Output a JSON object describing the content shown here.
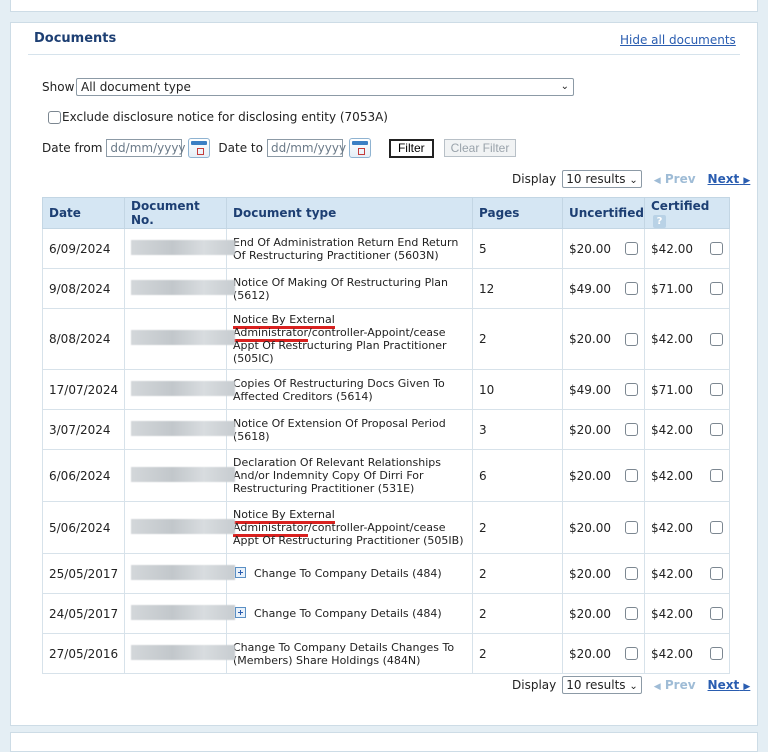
{
  "documents": {
    "title": "Documents",
    "hide_link": "Hide all documents",
    "show_label": "Show",
    "show_selected": "All document type",
    "exclude_label": "Exclude disclosure notice for disclosing entity (7053A)",
    "date_from_label": "Date from",
    "date_to_label": "Date to",
    "date_placeholder": "dd/mm/yyyy",
    "filter_label": "Filter",
    "clear_filter_label": "Clear Filter",
    "pager": {
      "display_label": "Display",
      "page_size": "10 results",
      "prev": "Prev",
      "next": "Next"
    },
    "columns": [
      "Date",
      "Document No.",
      "Document type",
      "Pages",
      "Uncertified",
      "Certified"
    ],
    "rows": [
      {
        "date": "6/09/2024",
        "type": "End Of Administration Return End Return Of Restructuring Practitioner (5603N)",
        "pages": "5",
        "uncertified": "$20.00",
        "certified": "$42.00"
      },
      {
        "date": "9/08/2024",
        "type": "Notice Of Making Of Restructuring Plan (5612)",
        "pages": "12",
        "uncertified": "$49.00",
        "certified": "$71.00"
      },
      {
        "date": "8/08/2024",
        "type_a": "Notice By External Administrator",
        "type_b": "/controller-Appoint/cease Appt Of Restructuring Plan Practitioner (505IC)",
        "pages": "2",
        "uncertified": "$20.00",
        "certified": "$42.00"
      },
      {
        "date": "17/07/2024",
        "type": "Copies Of Restructuring Docs Given To Affected Creditors (5614)",
        "pages": "10",
        "uncertified": "$49.00",
        "certified": "$71.00"
      },
      {
        "date": "3/07/2024",
        "type": "Notice Of Extension Of Proposal Period (5618)",
        "pages": "3",
        "uncertified": "$20.00",
        "certified": "$42.00"
      },
      {
        "date": "6/06/2024",
        "type": "Declaration Of Relevant Relationships And/or Indemnity Copy Of Dirri For Restructuring Practitioner (531E)",
        "pages": "6",
        "uncertified": "$20.00",
        "certified": "$42.00"
      },
      {
        "date": "5/06/2024",
        "type_a": "Notice By External Administrator",
        "type_b": "/controller-Appoint/cease Appt Of Restructuring Practitioner (505IB)",
        "pages": "2",
        "uncertified": "$20.00",
        "certified": "$42.00"
      },
      {
        "date": "25/05/2017",
        "type": "Change To Company Details (484)",
        "pages": "2",
        "uncertified": "$20.00",
        "certified": "$42.00"
      },
      {
        "date": "24/05/2017",
        "type": "Change To Company Details (484)",
        "pages": "2",
        "uncertified": "$20.00",
        "certified": "$42.00"
      },
      {
        "date": "27/05/2016",
        "type": "Change To Company Details Changes To (Members) Share Holdings (484N)",
        "pages": "2",
        "uncertified": "$20.00",
        "certified": "$42.00"
      }
    ]
  }
}
